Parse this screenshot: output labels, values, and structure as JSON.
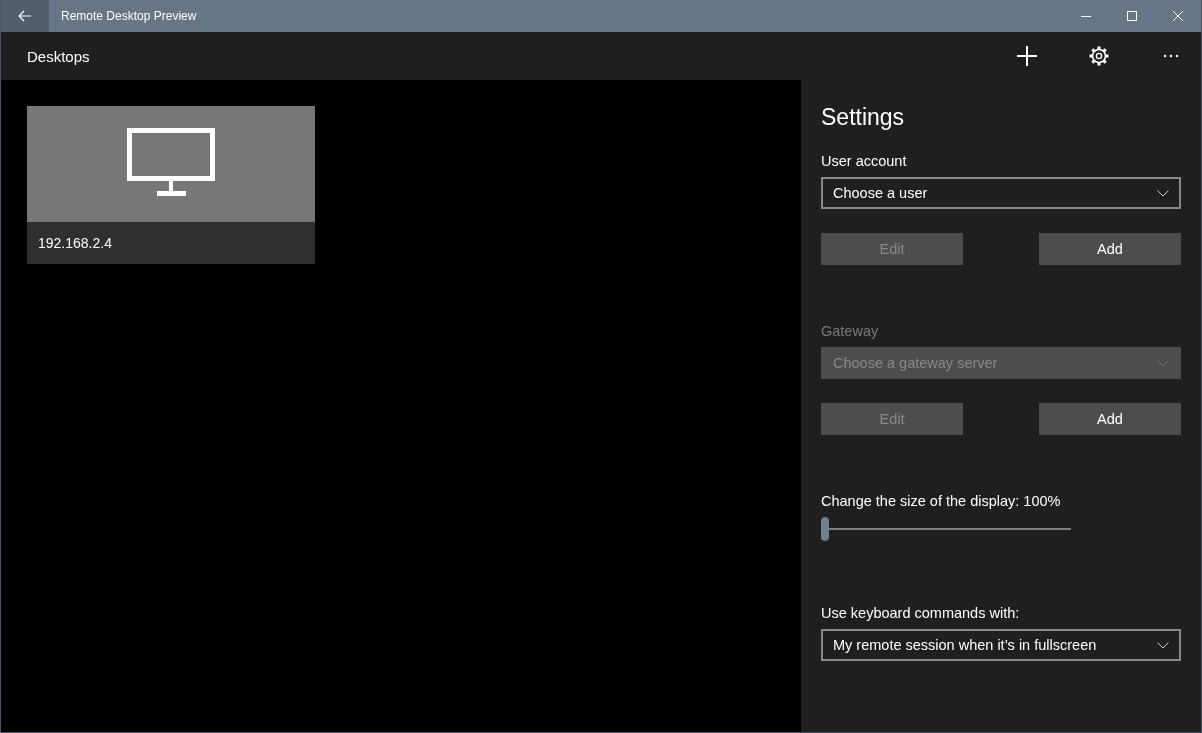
{
  "window": {
    "title": "Remote Desktop Preview"
  },
  "app_bar": {
    "title": "Desktops"
  },
  "desktops": [
    {
      "name": "192.168.2.4"
    }
  ],
  "settings": {
    "title": "Settings",
    "sections": [
      {
        "label": "User account",
        "disabled": false,
        "dropdown": {
          "value": "Choose a user",
          "disabled": false
        },
        "buttons": [
          {
            "label": "Edit",
            "disabled": true
          },
          {
            "label": "Add",
            "disabled": false
          }
        ]
      },
      {
        "label": "Gateway",
        "disabled": true,
        "dropdown": {
          "value": "Choose a gateway server",
          "disabled": true
        },
        "buttons": [
          {
            "label": "Edit",
            "disabled": true
          },
          {
            "label": "Add",
            "disabled": false
          }
        ]
      }
    ],
    "display": {
      "label": "Change the size of the display: 100%",
      "level": 0
    },
    "keyboard": {
      "label": "Use keyboard commands with:",
      "value": "My remote session when it’s in fullscreen"
    }
  }
}
